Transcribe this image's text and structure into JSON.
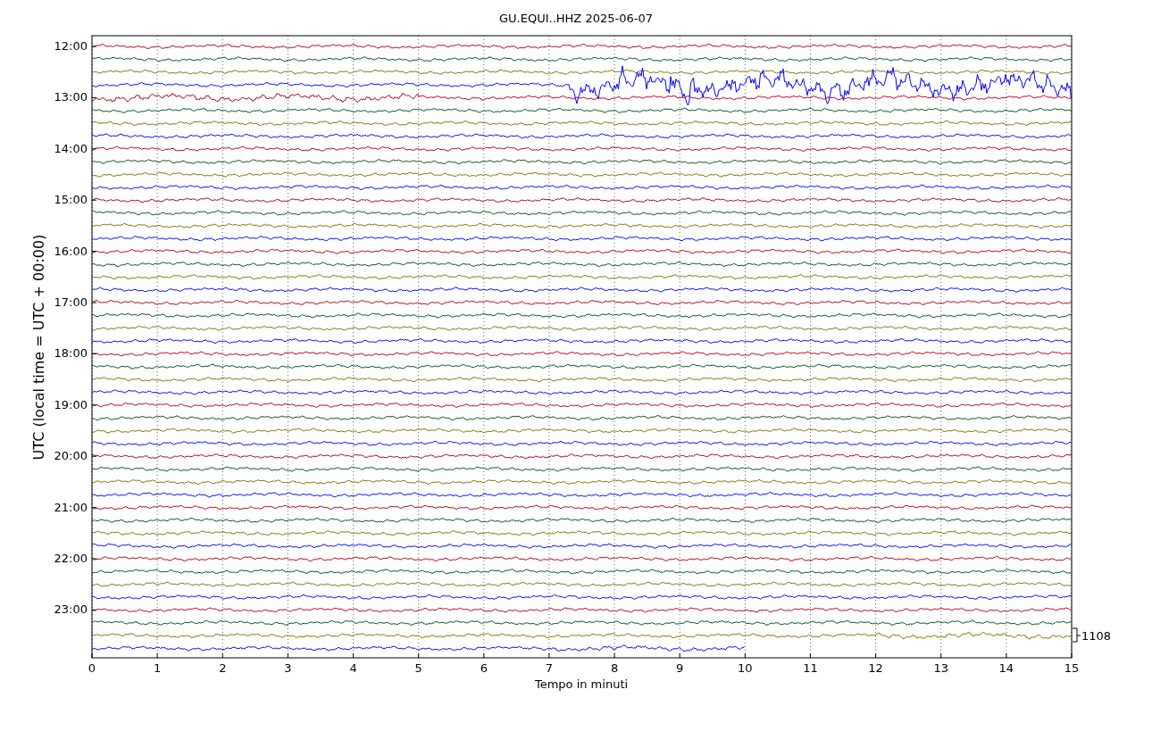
{
  "title": "GU.EQUI..HHZ 2025-06-07",
  "xlabel": "Tempo in minuti",
  "ylabel": "UTC (local time = UTC + 00:00)",
  "xticks": [
    "0",
    "1",
    "2",
    "3",
    "4",
    "5",
    "6",
    "7",
    "8",
    "9",
    "10",
    "11",
    "12",
    "13",
    "14",
    "15"
  ],
  "yticks": [
    "12:00",
    "13:00",
    "14:00",
    "15:00",
    "16:00",
    "17:00",
    "18:00",
    "19:00",
    "20:00",
    "21:00",
    "22:00",
    "23:00"
  ],
  "scale_label": "1108",
  "trace_palette": [
    {
      "color": "#b0001a"
    },
    {
      "color": "#00501e"
    },
    {
      "color": "#807000"
    },
    {
      "color": "#0000ff"
    }
  ]
}
